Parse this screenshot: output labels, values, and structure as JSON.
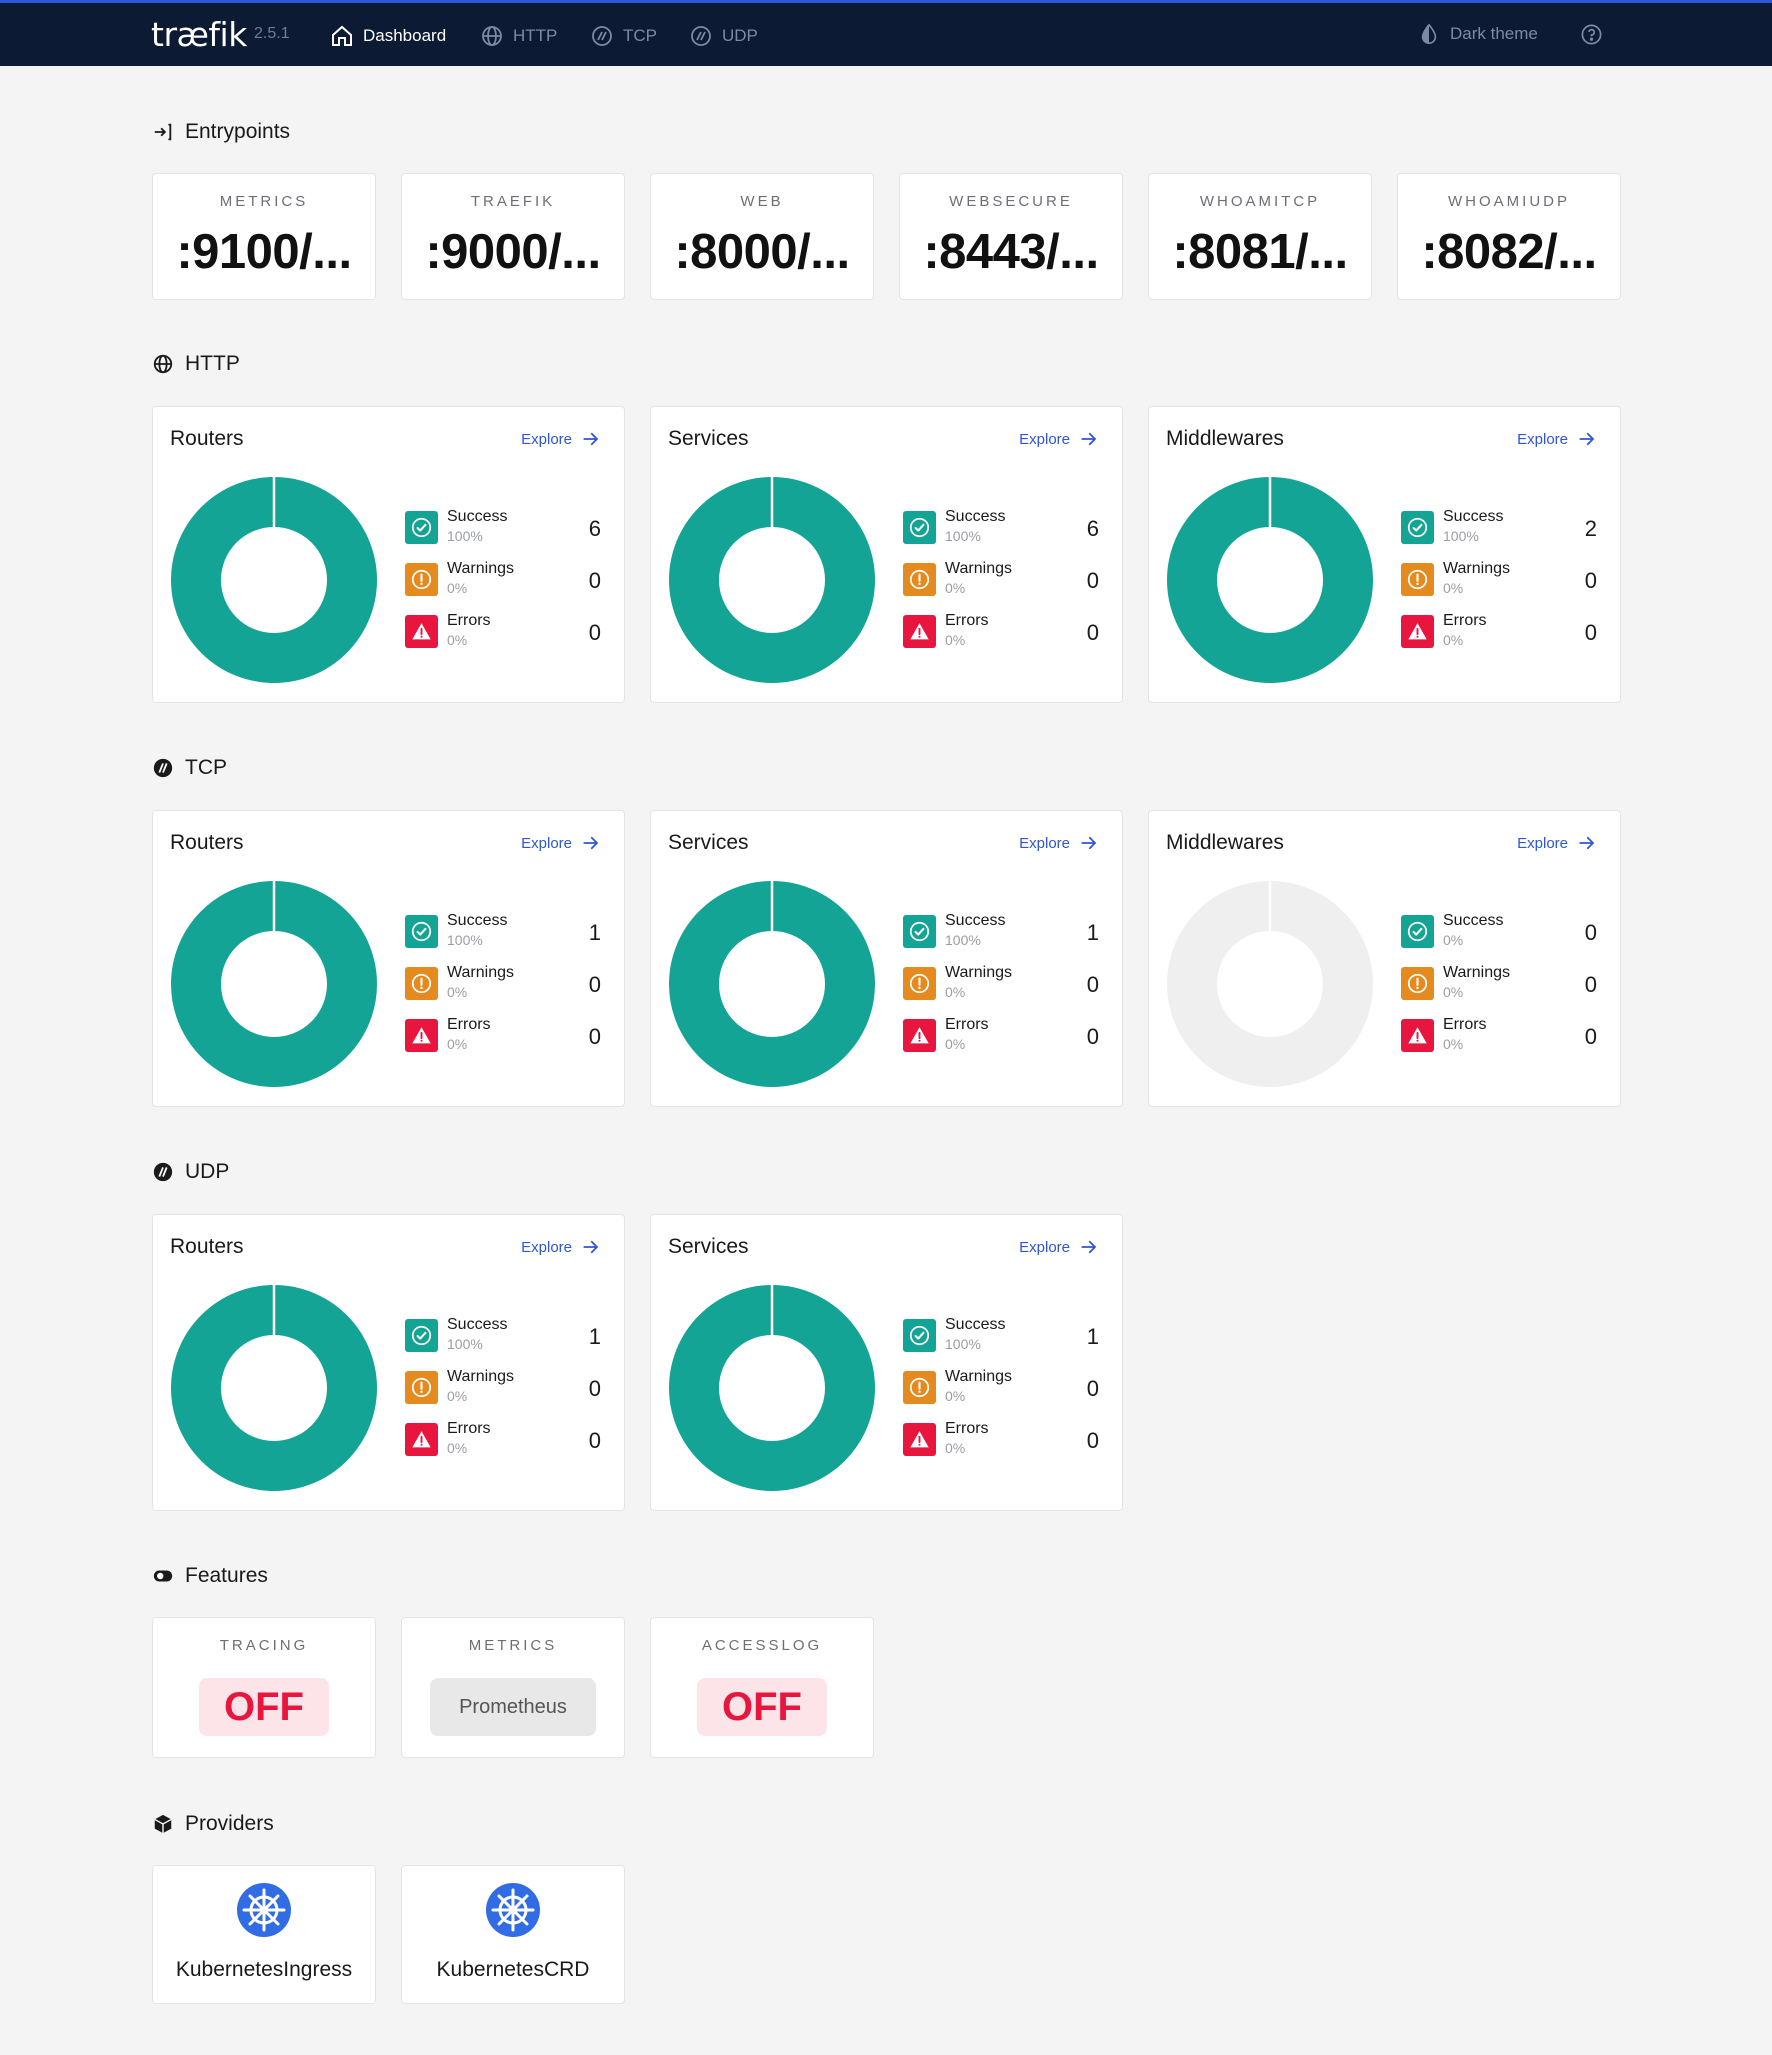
{
  "nav": {
    "brand": "træfik",
    "version": "2.5.1",
    "items": [
      {
        "label": "Dashboard",
        "icon": "home-icon",
        "active": true
      },
      {
        "label": "HTTP",
        "icon": "globe-icon"
      },
      {
        "label": "TCP",
        "icon": "tcp-icon"
      },
      {
        "label": "UDP",
        "icon": "udp-icon"
      }
    ],
    "theme_label": "Dark theme",
    "help_icon": "help-icon"
  },
  "entrypoints": {
    "title": "Entrypoints",
    "items": [
      {
        "name": "METRICS",
        "value": ":9100/..."
      },
      {
        "name": "TRAEFIK",
        "value": ":9000/..."
      },
      {
        "name": "WEB",
        "value": ":8000/..."
      },
      {
        "name": "WEBSECURE",
        "value": ":8443/..."
      },
      {
        "name": "WHOAMITCP",
        "value": ":8081/..."
      },
      {
        "name": "WHOAMIUDP",
        "value": ":8082/..."
      }
    ]
  },
  "labels": {
    "explore": "Explore",
    "success": "Success",
    "warnings": "Warnings",
    "errors": "Errors"
  },
  "colors": {
    "success": "#13a495",
    "warning": "#e58a1f",
    "error": "#e8163f",
    "empty": "#efefef",
    "accent": "#2f56d8",
    "nav_bg": "#0c1a33"
  },
  "http": {
    "title": "HTTP",
    "cards": [
      {
        "title": "Routers",
        "success": 6,
        "success_pct": "100%",
        "warnings": 0,
        "warnings_pct": "0%",
        "errors": 0,
        "errors_pct": "0%"
      },
      {
        "title": "Services",
        "success": 6,
        "success_pct": "100%",
        "warnings": 0,
        "warnings_pct": "0%",
        "errors": 0,
        "errors_pct": "0%"
      },
      {
        "title": "Middlewares",
        "success": 2,
        "success_pct": "100%",
        "warnings": 0,
        "warnings_pct": "0%",
        "errors": 0,
        "errors_pct": "0%"
      }
    ]
  },
  "tcp": {
    "title": "TCP",
    "cards": [
      {
        "title": "Routers",
        "success": 1,
        "success_pct": "100%",
        "warnings": 0,
        "warnings_pct": "0%",
        "errors": 0,
        "errors_pct": "0%"
      },
      {
        "title": "Services",
        "success": 1,
        "success_pct": "100%",
        "warnings": 0,
        "warnings_pct": "0%",
        "errors": 0,
        "errors_pct": "0%"
      },
      {
        "title": "Middlewares",
        "success": 0,
        "success_pct": "0%",
        "warnings": 0,
        "warnings_pct": "0%",
        "errors": 0,
        "errors_pct": "0%"
      }
    ]
  },
  "udp": {
    "title": "UDP",
    "cards": [
      {
        "title": "Routers",
        "success": 1,
        "success_pct": "100%",
        "warnings": 0,
        "warnings_pct": "0%",
        "errors": 0,
        "errors_pct": "0%"
      },
      {
        "title": "Services",
        "success": 1,
        "success_pct": "100%",
        "warnings": 0,
        "warnings_pct": "0%",
        "errors": 0,
        "errors_pct": "0%"
      }
    ]
  },
  "features": {
    "title": "Features",
    "items": [
      {
        "name": "TRACING",
        "value": "OFF",
        "state": "off"
      },
      {
        "name": "METRICS",
        "value": "Prometheus",
        "state": "on"
      },
      {
        "name": "ACCESSLOG",
        "value": "OFF",
        "state": "off"
      }
    ]
  },
  "providers": {
    "title": "Providers",
    "items": [
      {
        "name": "KubernetesIngress",
        "icon": "kubernetes-icon"
      },
      {
        "name": "KubernetesCRD",
        "icon": "kubernetes-icon"
      }
    ]
  }
}
